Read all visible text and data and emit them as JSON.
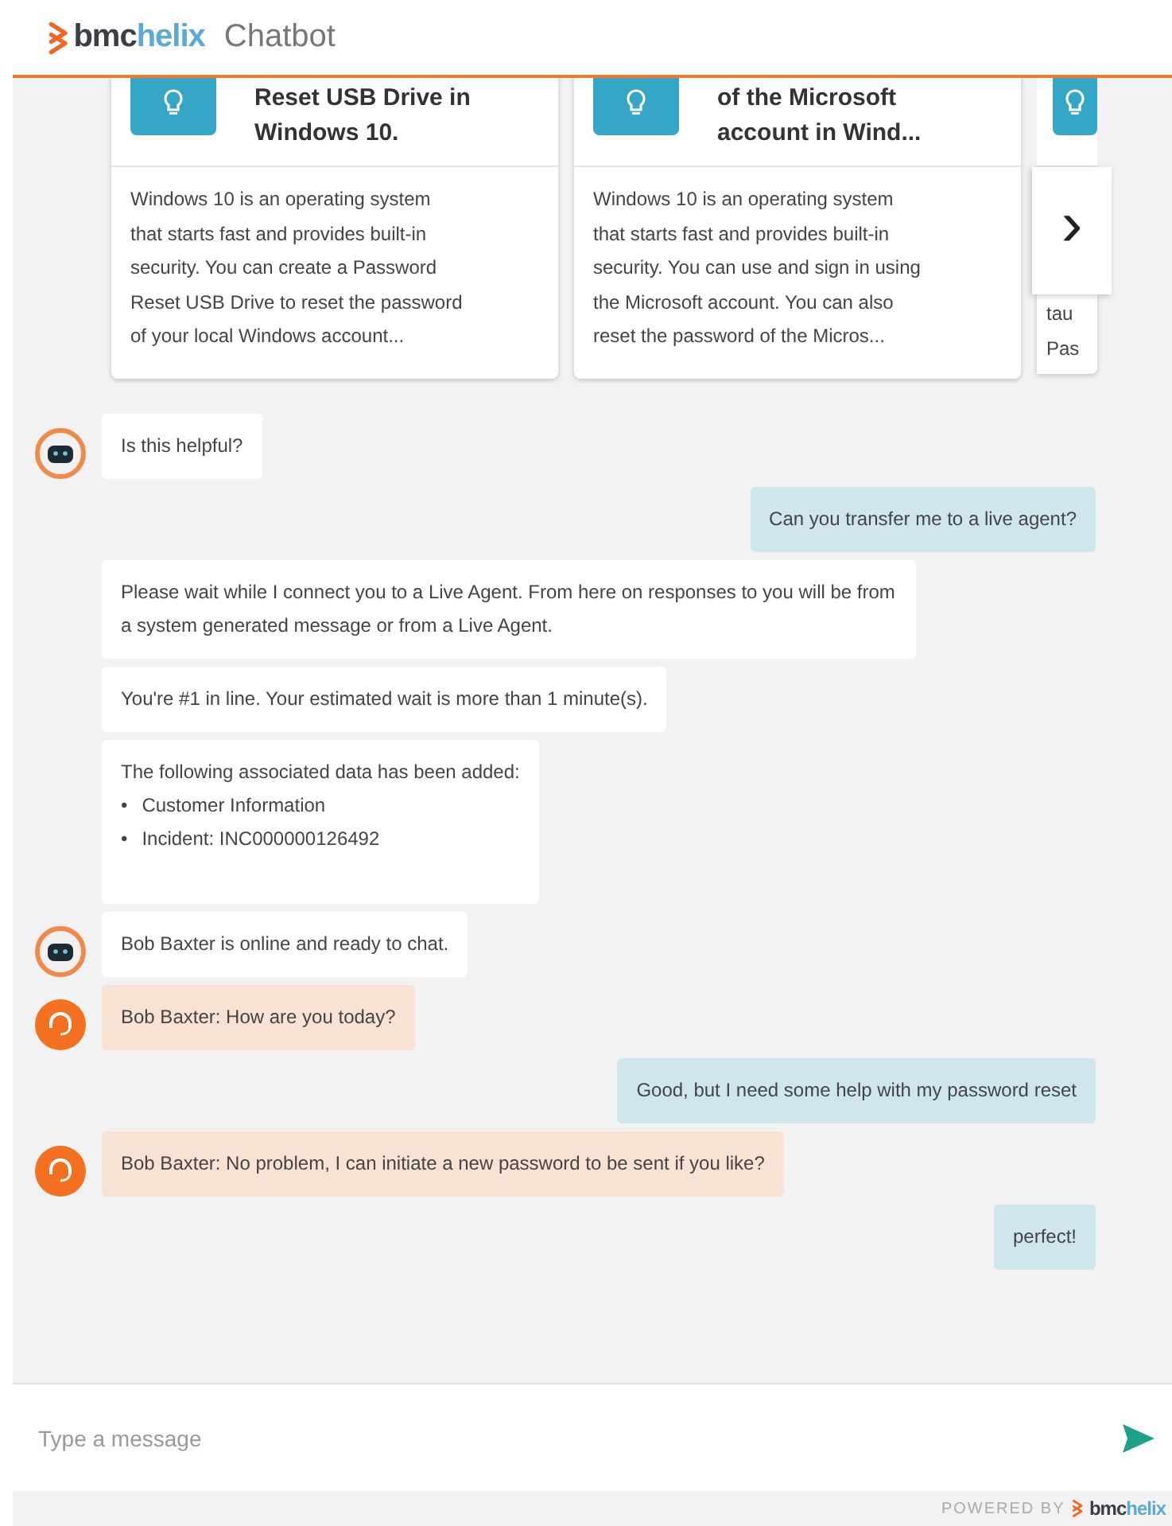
{
  "header": {
    "brand_prefix": "bmc",
    "brand_suffix": "helix",
    "title": "Chatbot"
  },
  "cards": [
    {
      "title_lines": [
        "Reset USB Drive in",
        "Windows 10."
      ],
      "body_lines": [
        "Windows 10 is an operating system",
        "that starts fast and provides built-in",
        "security. You can create a Password",
        "Reset USB Drive to reset the password",
        "of your local Windows account..."
      ]
    },
    {
      "title_lines": [
        "of the Microsoft",
        "account in Wind..."
      ],
      "body_lines": [
        "Windows 10 is an operating system",
        "that starts fast and provides built-in",
        "security. You can use and sign in using",
        "the Microsoft account. You can also",
        "reset the password of the Micros..."
      ]
    },
    {
      "body_lines": [
        "tau",
        "Pas"
      ]
    }
  ],
  "next_button": "›",
  "messages": [
    {
      "kind": "bot",
      "text": "Is this helpful?"
    },
    {
      "kind": "user",
      "text": "Can you transfer me to a live agent?"
    },
    {
      "kind": "system",
      "text": "Please wait while I connect you to a Live Agent. From here on responses to you will be from a system generated message or from a Live Agent."
    },
    {
      "kind": "system",
      "text": "You're #1 in line. Your estimated wait is more than 1 minute(s)."
    },
    {
      "kind": "system",
      "text": "The following associated data has been added:",
      "bullet": "•",
      "items": [
        "Customer Information",
        "Incident: INC000000126492"
      ]
    },
    {
      "kind": "bot",
      "text": "Bob Baxter is online and ready to chat."
    },
    {
      "kind": "agent",
      "text": "Bob Baxter: How are you today?"
    },
    {
      "kind": "user",
      "text": "Good, but I need some help with my password reset"
    },
    {
      "kind": "agent",
      "text": "Bob Baxter: No problem, I can initiate a new password to be sent if you like?"
    },
    {
      "kind": "user",
      "text": "perfect!"
    }
  ],
  "composer": {
    "placeholder": "Type a message"
  },
  "footer": {
    "powered_by": "POWERED BY",
    "brand_prefix": "bmc",
    "brand_suffix": "helix"
  }
}
